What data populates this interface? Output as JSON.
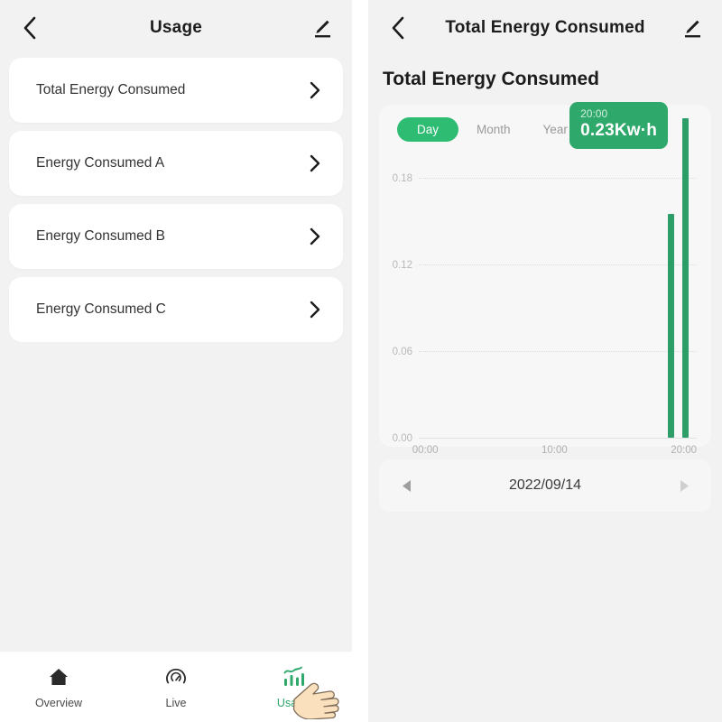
{
  "left_panel": {
    "header": {
      "back_icon": "chevron-left-icon",
      "title": "Usage",
      "edit_icon": "pencil-edit-icon"
    },
    "list": [
      {
        "label": "Total Energy Consumed",
        "chevron": "chevron-right-icon"
      },
      {
        "label": "Energy Consumed A",
        "chevron": "chevron-right-icon"
      },
      {
        "label": "Energy Consumed B",
        "chevron": "chevron-right-icon"
      },
      {
        "label": "Energy Consumed C",
        "chevron": "chevron-right-icon"
      }
    ],
    "tabbar": {
      "items": [
        {
          "label": "Overview",
          "icon": "home-icon",
          "active": false
        },
        {
          "label": "Live",
          "icon": "gauge-icon",
          "active": false
        },
        {
          "label": "Usage",
          "icon": "bar-chart-icon",
          "active": true
        }
      ],
      "cursor": "pointing-hand-cursor"
    }
  },
  "right_panel": {
    "header": {
      "back_icon": "chevron-left-icon",
      "title": "Total Energy Consumed",
      "edit_icon": "pencil-edit-icon"
    },
    "page_title": "Total Energy Consumed",
    "segments": [
      {
        "label": "Day",
        "active": true
      },
      {
        "label": "Month",
        "active": false
      },
      {
        "label": "Year",
        "active": false
      }
    ],
    "tooltip": {
      "time": "20:00",
      "value": "0.23Kw·h"
    },
    "date_nav": {
      "prev_icon": "triangle-left-icon",
      "date": "2022/09/14",
      "next_icon": "triangle-right-icon"
    }
  },
  "colors": {
    "accent_green": "#2FA96B",
    "pill_green": "#2EBC72",
    "bar_green": "#2E9E68",
    "page_bg": "#f2f2f2",
    "card_bg": "#ffffff",
    "text_primary": "#1c1c1c",
    "text_muted": "#9a9a9a"
  },
  "chart_data": {
    "type": "bar",
    "title": "Total Energy Consumed",
    "xlabel": "",
    "ylabel": "Kw·h",
    "unit": "Kw·h",
    "period": "Day",
    "date": "2022/09/14",
    "ylim": [
      0.0,
      0.2
    ],
    "ytick_labels": [
      "0.00",
      "0.06",
      "0.12",
      "0.18"
    ],
    "ytick_values": [
      0.0,
      0.06,
      0.12,
      0.18
    ],
    "xtick_labels": [
      "00:00",
      "10:00",
      "20:00"
    ],
    "xtick_values": [
      0,
      10,
      20
    ],
    "xlim": [
      -0.5,
      21
    ],
    "grid": "horizontal-dotted",
    "legend": "none",
    "categories": [
      "19:00",
      "20:00"
    ],
    "values": [
      0.155,
      0.23
    ],
    "highlighted_index": 1,
    "annotation": {
      "time": "20:00",
      "value": "0.23Kw·h"
    },
    "series": [
      {
        "name": "Total Energy Consumed",
        "values": [
          0.155,
          0.23
        ]
      }
    ]
  }
}
